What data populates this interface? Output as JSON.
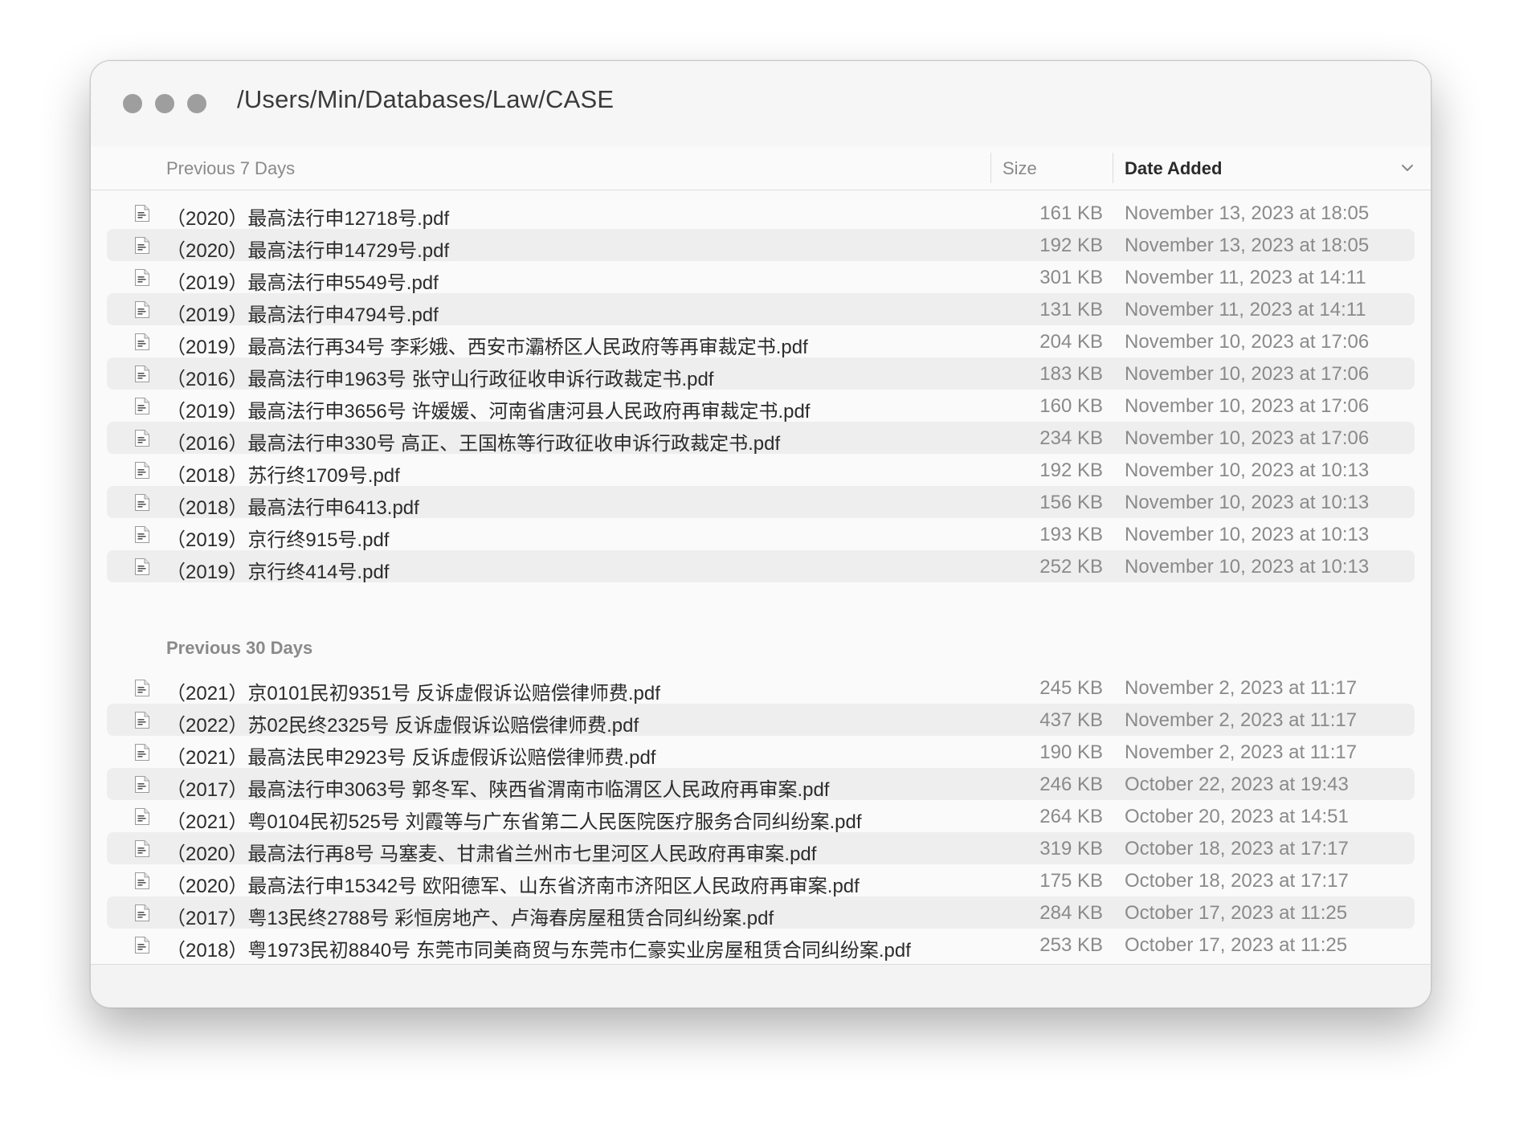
{
  "window": {
    "title": "/Users/Min/Databases/Law/CASE"
  },
  "columns": {
    "name": "Previous 7 Days",
    "size": "Size",
    "date": "Date Added"
  },
  "groups": [
    {
      "label": "Previous 7 Days",
      "files": [
        {
          "name": "（2020）最高法行申12718号.pdf",
          "size": "161 KB",
          "date": "November 13, 2023 at 18:05"
        },
        {
          "name": "（2020）最高法行申14729号.pdf",
          "size": "192 KB",
          "date": "November 13, 2023 at 18:05"
        },
        {
          "name": "（2019）最高法行申5549号.pdf",
          "size": "301 KB",
          "date": "November 11, 2023 at 14:11"
        },
        {
          "name": "（2019）最高法行申4794号.pdf",
          "size": "131 KB",
          "date": "November 11, 2023 at 14:11"
        },
        {
          "name": "（2019）最高法行再34号 李彩娥、西安市灞桥区人民政府等再审裁定书.pdf",
          "size": "204 KB",
          "date": "November 10, 2023 at 17:06"
        },
        {
          "name": "（2016）最高法行申1963号 张守山行政征收申诉行政裁定书.pdf",
          "size": "183 KB",
          "date": "November 10, 2023 at 17:06"
        },
        {
          "name": "（2019）最高法行申3656号 许媛媛、河南省唐河县人民政府再审裁定书.pdf",
          "size": "160 KB",
          "date": "November 10, 2023 at 17:06"
        },
        {
          "name": "（2016）最高法行申330号 高正、王国栋等行政征收申诉行政裁定书.pdf",
          "size": "234 KB",
          "date": "November 10, 2023 at 17:06"
        },
        {
          "name": "（2018）苏行终1709号.pdf",
          "size": "192 KB",
          "date": "November 10, 2023 at 10:13"
        },
        {
          "name": "（2018）最高法行申6413.pdf",
          "size": "156 KB",
          "date": "November 10, 2023 at 10:13"
        },
        {
          "name": "（2019）京行终915号.pdf",
          "size": "193 KB",
          "date": "November 10, 2023 at 10:13"
        },
        {
          "name": "（2019）京行终414号.pdf",
          "size": "252 KB",
          "date": "November 10, 2023 at 10:13"
        }
      ]
    },
    {
      "label": "Previous 30 Days",
      "files": [
        {
          "name": "（2021）京0101民初9351号 反诉虚假诉讼赔偿律师费.pdf",
          "size": "245 KB",
          "date": "November 2, 2023 at 11:17"
        },
        {
          "name": "（2022）苏02民终2325号 反诉虚假诉讼赔偿律师费.pdf",
          "size": "437 KB",
          "date": "November 2, 2023 at 11:17"
        },
        {
          "name": "（2021）最高法民申2923号 反诉虚假诉讼赔偿律师费.pdf",
          "size": "190 KB",
          "date": "November 2, 2023 at 11:17"
        },
        {
          "name": "（2017）最高法行申3063号 郭冬军、陕西省渭南市临渭区人民政府再审案.pdf",
          "size": "246 KB",
          "date": "October 22, 2023 at 19:43"
        },
        {
          "name": "（2021）粤0104民初525号 刘霞等与广东省第二人民医院医疗服务合同纠纷案.pdf",
          "size": "264 KB",
          "date": "October 20, 2023 at 14:51"
        },
        {
          "name": "（2020）最高法行再8号 马塞麦、甘肃省兰州市七里河区人民政府再审案.pdf",
          "size": "319 KB",
          "date": "October 18, 2023 at 17:17"
        },
        {
          "name": "（2020）最高法行申15342号 欧阳德军、山东省济南市济阳区人民政府再审案.pdf",
          "size": "175 KB",
          "date": "October 18, 2023 at 17:17"
        },
        {
          "name": "（2017）粤13民终2788号 彩恒房地产、卢海春房屋租赁合同纠纷案.pdf",
          "size": "284 KB",
          "date": "October 17, 2023 at 11:25"
        },
        {
          "name": "（2018）粤1973民初8840号 东莞市同美商贸与东莞市仁豪实业房屋租赁合同纠纷案.pdf",
          "size": "253 KB",
          "date": "October 17, 2023 at 11:25"
        }
      ]
    }
  ]
}
